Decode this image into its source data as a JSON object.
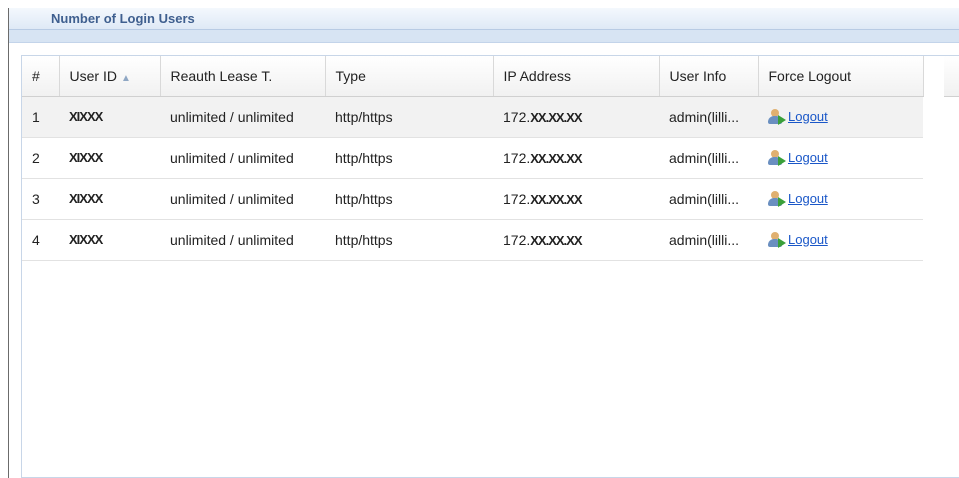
{
  "panel": {
    "title": "Number of Login Users"
  },
  "columns": [
    "#",
    "User ID",
    "Reauth Lease T.",
    "Type",
    "IP Address",
    "User Info",
    "Force Logout"
  ],
  "rows": [
    {
      "num": "1",
      "user_id": "XIXXX",
      "reauth": "unlimited / unlimited",
      "type": "http/https",
      "ip_prefix": "172.",
      "ip_mask": "XX.XX.XX",
      "user_info": "admin(lilli...",
      "logout": "Logout"
    },
    {
      "num": "2",
      "user_id": "XIXXX",
      "reauth": "unlimited / unlimited",
      "type": "http/https",
      "ip_prefix": "172.",
      "ip_mask": "XX.XX.XX",
      "user_info": "admin(lilli...",
      "logout": "Logout"
    },
    {
      "num": "3",
      "user_id": "XIXXX",
      "reauth": "unlimited / unlimited",
      "type": "http/https",
      "ip_prefix": "172.",
      "ip_mask": "XX.XX.XX",
      "user_info": "admin(lilli...",
      "logout": "Logout"
    },
    {
      "num": "4",
      "user_id": "XIXXX",
      "reauth": "unlimited / unlimited",
      "type": "http/https",
      "ip_prefix": "172.",
      "ip_mask": "XX.XX.XX",
      "user_info": "admin(lilli...",
      "logout": "Logout"
    }
  ],
  "sort": {
    "column": "User ID",
    "direction": "ascending",
    "icon": "sort-asc-icon"
  },
  "colors": {
    "panel_title": "#3f5f8f",
    "link": "#1a57c8",
    "header_band": "#d7e4f3"
  }
}
